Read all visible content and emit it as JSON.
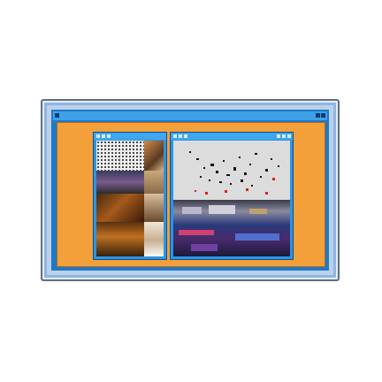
{
  "colors": {
    "desktop": "#f3a03b",
    "frame": "#1d79c9",
    "window_bar": "#3fa6f0"
  },
  "left_window": {
    "icons": [
      "image-collage-icon"
    ]
  },
  "right_window": {
    "icons": [
      "scatter-plot-icon",
      "scene-image-icon"
    ]
  }
}
